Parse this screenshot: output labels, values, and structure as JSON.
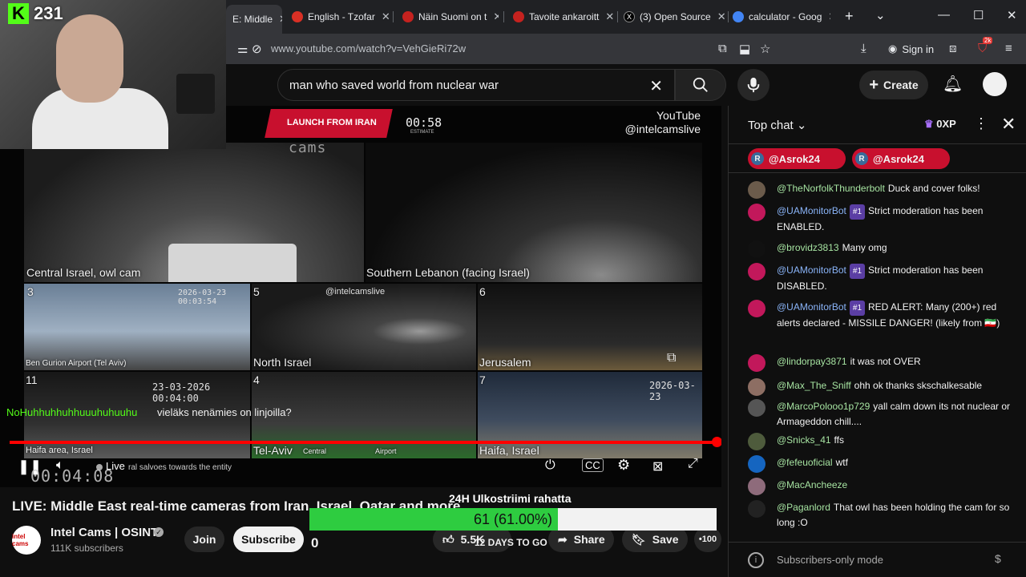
{
  "browser": {
    "tabs": [
      {
        "label": "E: Middle",
        "color": "#35363a",
        "active": true
      },
      {
        "label": "English - Tzofar",
        "color": "#d93025"
      },
      {
        "label": "Näin Suomi on t",
        "color": "#c5221f"
      },
      {
        "label": "Tavoite ankaroitt",
        "color": "#c5221f"
      },
      {
        "label": "(3) Open Source",
        "color": "#000000"
      },
      {
        "label": "calculator - Goog",
        "color": "#4285f4"
      }
    ],
    "new_tab": "+",
    "url": "www.youtube.com/watch?v=VehGieRi72w",
    "sign_in": "Sign in",
    "ext_badge": "2k"
  },
  "webcam": {
    "platform_logo": "K",
    "viewer_count": "231"
  },
  "youtube": {
    "search_query": "man who saved world from nuclear war",
    "create_label": "Create"
  },
  "video": {
    "launch_banner": "LAUNCH FROM IRAN",
    "countdown": "00:58",
    "countdown_sub": "ESTIMATE",
    "handle_line1": "YouTube",
    "handle_line2": "@intelcamslive",
    "brand": "cams",
    "watermark": "@intelcamslive",
    "cells": {
      "c1": {
        "label": "Central Israel, owl cam"
      },
      "c2": {
        "label": "Southern Lebanon (facing Israel)"
      },
      "c3": {
        "num": "3",
        "timestamp": "2026-03-23 00:03:54",
        "label": "Ben Gurion Airport (Tel Aviv)"
      },
      "c5": {
        "num": "5",
        "label": "North Israel"
      },
      "c6": {
        "num": "6",
        "label": "Jerusalem"
      },
      "c11": {
        "num": "11",
        "timestamp": "23-03-2026 00:04:00",
        "label": "Haifa area, Israel"
      },
      "c4": {
        "num": "4",
        "label": "Tel-Aviv",
        "sub1": "Central",
        "sub2": "Airport"
      },
      "c7": {
        "num": "7",
        "timestamp": "2026-03-23",
        "label": "Haifa, Israel"
      }
    },
    "chat_overlay": {
      "user": "NoHuhhuhhuhhuuuhuhuuhu",
      "message": "vieläks nenämies on linjoilla?"
    },
    "live_label": "Live",
    "ticker": "ral salvoes towards the entity",
    "timer": "00:04:08",
    "progress": 0.995
  },
  "info": {
    "title": "LIVE: Middle East real-time cameras from Iran, Israel, Qatar and more",
    "channel_name": "Intel Cams | OSINT",
    "channel_avatar_text": "intel cams",
    "subscribers": "111K subscribers",
    "join": "Join",
    "subscribe": "Subscribe",
    "zero": "0",
    "likes": "5.5K",
    "share": "Share",
    "save": "Save",
    "more": "•100"
  },
  "donation": {
    "title": "24H Ulkostriimi rahatta",
    "progress_text": "61 (61.00%)",
    "progress": 0.61,
    "days_left": "12 DAYS TO GO"
  },
  "chat": {
    "mode": "Top chat",
    "xp": "0XP",
    "pinned": [
      "@Asrok24",
      "@Asrok24"
    ],
    "messages": [
      {
        "author": "@TheNorfolkThunderbolt",
        "text": "Duck and cover folks!",
        "avatar_color": "#6b5b4b"
      },
      {
        "author": "@UAMonitorBot",
        "badge": "#1",
        "text": "Strict moderation has been ENABLED.",
        "avatar_color": "#c2185b"
      },
      {
        "author": "@brovidz3813",
        "text": "Many omg",
        "avatar_color": "#111111"
      },
      {
        "author": "@UAMonitorBot",
        "badge": "#1",
        "text": "Strict moderation has been DISABLED.",
        "avatar_color": "#c2185b"
      },
      {
        "author": "@UAMonitorBot",
        "badge": "#1",
        "text": "RED ALERT: Many (200+) red alerts declared - MISSILE DANGER! (likely from 🇮🇷)",
        "avatar_color": "#c2185b"
      },
      {
        "author": "@lindorpay3871",
        "text": "it was not OVER",
        "avatar_color": "#c2185b"
      },
      {
        "author": "@Max_The_Sniff",
        "text": "ohh ok thanks skschalkesable",
        "avatar_color": "#8d6e63"
      },
      {
        "author": "@MarcoPolooo1p729",
        "text": "yall calm down its not nuclear or Armageddon chill....",
        "avatar_color": "#555555"
      },
      {
        "author": "@Snicks_41",
        "text": "ffs",
        "avatar_color": "#4e5b3c"
      },
      {
        "author": "@fefeuoficial",
        "text": "wtf",
        "avatar_color": "#1565c0"
      },
      {
        "author": "@MacAncheeze",
        "text": "",
        "avatar_color": "#8e6b7b"
      },
      {
        "author": "@Paganlord",
        "text": "That owl has been holding the cam for so long :O",
        "avatar_color": "#222222"
      }
    ],
    "footer": "Subscribers-only mode",
    "footer_info": "i",
    "footer_cash": "$"
  }
}
